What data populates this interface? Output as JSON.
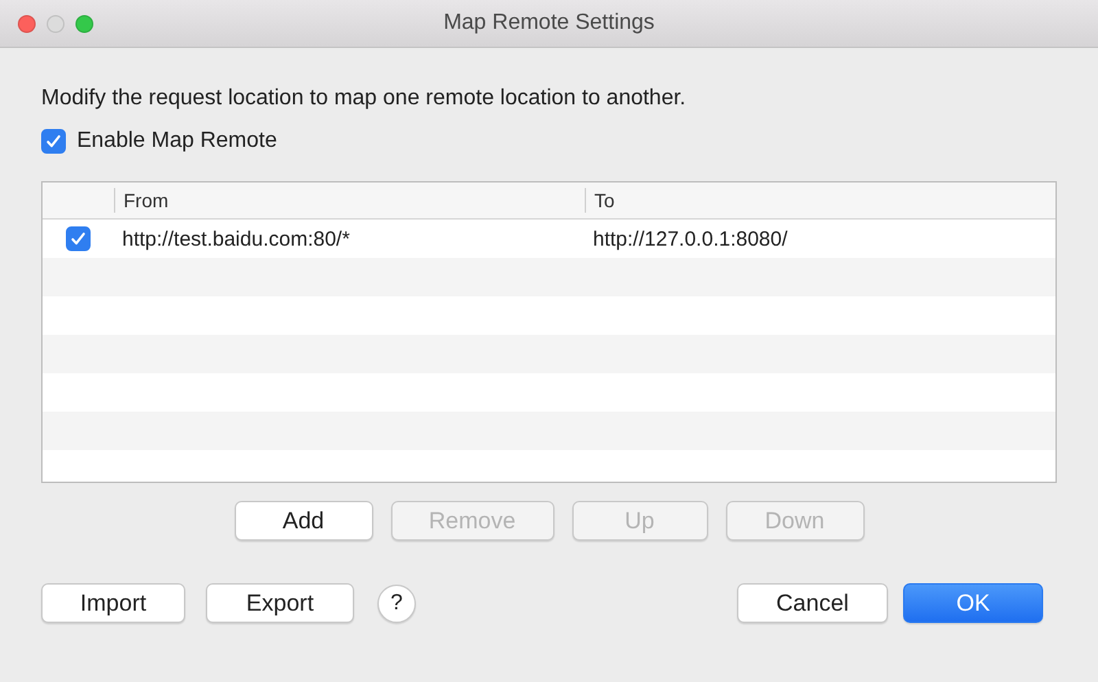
{
  "window": {
    "title": "Map Remote Settings"
  },
  "description": "Modify the request location to map one remote location to another.",
  "enable": {
    "label": "Enable Map Remote",
    "checked": true
  },
  "table": {
    "columns": [
      "From",
      "To"
    ],
    "rows": [
      {
        "checked": true,
        "from": "http://test.baidu.com:80/*",
        "to": "http://127.0.0.1:8080/"
      }
    ]
  },
  "row_buttons": [
    {
      "label": "Add",
      "disabled": false
    },
    {
      "label": "Remove",
      "disabled": true
    },
    {
      "label": "Up",
      "disabled": true
    },
    {
      "label": "Down",
      "disabled": true
    }
  ],
  "left_buttons": [
    "Import",
    "Export"
  ],
  "help": "?",
  "right_buttons": [
    {
      "label": "Cancel",
      "kind": "normal"
    },
    {
      "label": "OK",
      "kind": "default"
    }
  ]
}
